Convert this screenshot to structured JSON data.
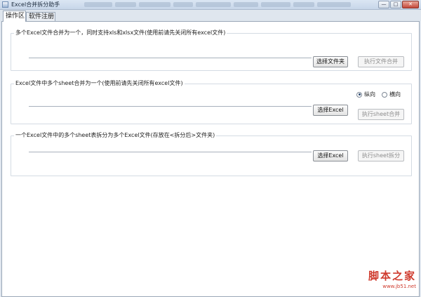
{
  "window": {
    "title": "Excel合并拆分助手",
    "buttons": {
      "minimize": "—",
      "maximize": "□",
      "close": "✕"
    }
  },
  "tabs": [
    {
      "label": "操作区",
      "active": true
    },
    {
      "label": "软件注册",
      "active": false
    }
  ],
  "section_merge_files": {
    "title": "多个Excel文件合并为一个，同时支持xls和xlsx文件(使用前请先关闭所有excel文件)",
    "path_value": "",
    "choose_button": "选择文件夹",
    "execute_button": "执行文件合并"
  },
  "section_merge_sheets": {
    "title": "Excel文件中多个sheet合并为一个(使用前请先关闭所有excel文件)",
    "path_value": "",
    "choose_button": "选择Excel",
    "execute_button": "执行sheet合并",
    "orientation": {
      "options": [
        "纵向",
        "横向"
      ],
      "selected": "纵向"
    }
  },
  "section_split_sheets": {
    "title": "一个Excel文件中的多个sheet表拆分为多个Excel文件(存放在<拆分后>文件夹)",
    "path_value": "",
    "choose_button": "选择Excel",
    "execute_button": "执行sheet拆分"
  },
  "watermark": {
    "main": "脚本之家",
    "url": "www.jb51.net"
  },
  "colors": {
    "accent": "#2c4a72",
    "watermark": "#cf3b2e",
    "disabled_text": "#8d8d8d"
  }
}
